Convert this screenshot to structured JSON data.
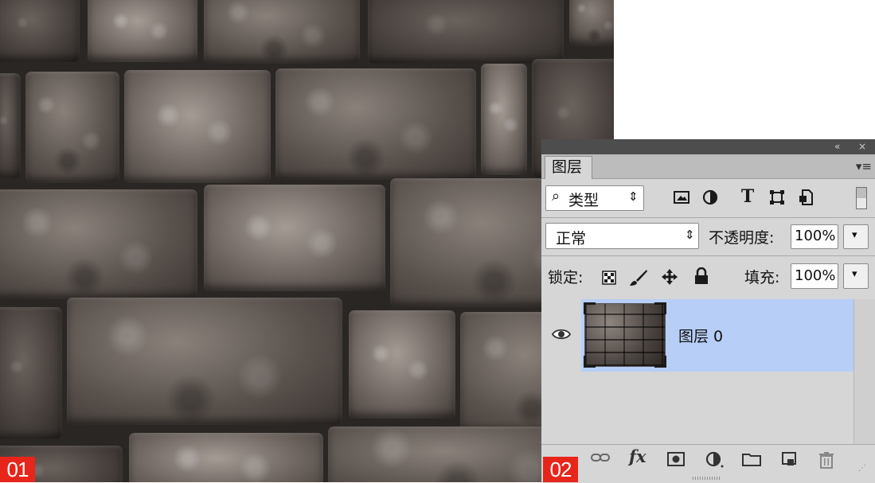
{
  "labels": {
    "tag1": "01",
    "tag2": "02"
  },
  "panel": {
    "titlebar": {
      "collapse_icon": "«",
      "close_icon": "×"
    },
    "tab_label": "图层",
    "menu_icon": "▾≡",
    "filter": {
      "search_icon": "⌕",
      "kind_value": "类型",
      "stepper_icon": "⇕",
      "filter_icons": [
        "image-filter-icon",
        "adjustment-filter-icon",
        "type-filter-icon",
        "shape-filter-icon",
        "smart-object-filter-icon"
      ],
      "type_glyph": "T"
    },
    "blend": {
      "mode": "正常",
      "opacity_label": "不透明度:",
      "opacity_value": "100%"
    },
    "lock": {
      "label": "锁定:",
      "fill_label": "填充:",
      "fill_value": "100%"
    },
    "layer": {
      "name": "图层 0",
      "visible": true
    },
    "footer_icons": [
      "link-layers-icon",
      "fx-icon",
      "add-mask-icon",
      "new-adjustment-icon",
      "new-group-icon",
      "new-layer-icon",
      "delete-layer-icon"
    ],
    "fx_text": "fx",
    "colors": {
      "selected_row": "#b7cef7",
      "panel_bg": "#d6d6d6",
      "titlebar": "#4d4d4d",
      "tag_red": "#e8251a"
    }
  }
}
